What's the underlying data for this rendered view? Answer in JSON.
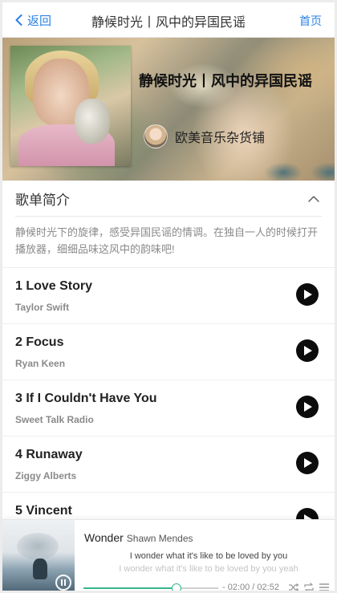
{
  "nav": {
    "back_label": "返回",
    "title": "静候时光丨风中的异国民谣",
    "home_label": "首页"
  },
  "playlist": {
    "title": "静候时光丨风中的异国民谣",
    "author": "欧美音乐杂货铺"
  },
  "intro": {
    "heading": "歌单简介",
    "text": "静候时光下的旋律，感受异国民谣的情调。在独自一人的时候打开播放器，细细品味这风中的韵味吧!"
  },
  "songs": [
    {
      "title": "1 Love Story",
      "artist": "Taylor Swift"
    },
    {
      "title": "2 Focus",
      "artist": "Ryan Keen"
    },
    {
      "title": "3 If I Couldn't Have You",
      "artist": "Sweet Talk Radio"
    },
    {
      "title": "4 Runaway",
      "artist": "Ziggy Alberts"
    },
    {
      "title": "5 Vincent",
      "artist": ""
    }
  ],
  "player": {
    "title": "Wonder",
    "artist": "Shawn Mendes",
    "lyric_current": "I wonder what it's like to be loved by you",
    "lyric_next": "I wonder what it's like to be loved by you yeah",
    "time_label": "- 02:00 / 02:52",
    "progress": 0.69,
    "accent_color": "#35b58a"
  },
  "icons": {
    "back": "chevron-left-icon",
    "collapse": "chevron-up-icon",
    "play": "play-icon",
    "pause": "pause-icon",
    "shuffle": "shuffle-icon",
    "repeat": "repeat-icon",
    "list": "playlist-icon"
  }
}
